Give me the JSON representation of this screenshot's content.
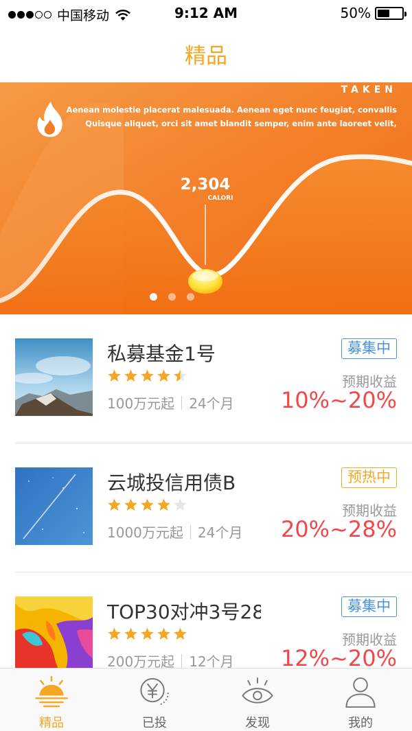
{
  "status_bar": {
    "carrier": "中国移动",
    "time": "9:12 AM",
    "battery": "50%",
    "battery_level": 0.5,
    "signal_bars": 3,
    "signal_total": 5
  },
  "nav": {
    "title": "精品"
  },
  "banner": {
    "brand": "TAKEN",
    "text_line1": "Aenean molestie placerat malesuada. Aenean eget nunc feugiat, convallis",
    "text_line2": "Quisque aliquet, orci sit amet blandit semper, enim ante laoreet velit,",
    "value": "2,304",
    "unit": "CALORI",
    "page_count": 3,
    "active_page": 0,
    "icon": "flame-icon"
  },
  "products": [
    {
      "title": "私募基金1号",
      "rating": 4.5,
      "min_amount": "100万元起",
      "term": "24个月",
      "status": "募集中",
      "status_color": "blue",
      "yield_label": "预期收益",
      "yield": "10%~20%",
      "thumb": "mountain"
    },
    {
      "title": "云城投信用债B",
      "rating": 4,
      "min_amount": "1000万元起",
      "term": "24个月",
      "status": "预热中",
      "status_color": "orange",
      "yield_label": "预期收益",
      "yield": "20%~28%",
      "thumb": "sky"
    },
    {
      "title": "TOP30对冲3号28",
      "rating": 5,
      "min_amount": "200万元起",
      "term": "12个月",
      "status": "募集中",
      "status_color": "blue",
      "yield_label": "预期收益",
      "yield": "12%~20%",
      "thumb": "paint"
    }
  ],
  "tabs": [
    {
      "label": "精品",
      "icon": "sunrise-icon",
      "active": true
    },
    {
      "label": "已投",
      "icon": "yen-coin-icon",
      "active": false
    },
    {
      "label": "发现",
      "icon": "eye-icon",
      "active": false
    },
    {
      "label": "我的",
      "icon": "person-icon",
      "active": false
    }
  ],
  "colors": {
    "accent": "#f5a623",
    "banner": "#f37a22",
    "yield": "#f2474a",
    "badge_blue": "#4a90e2",
    "badge_orange": "#f5a623"
  }
}
